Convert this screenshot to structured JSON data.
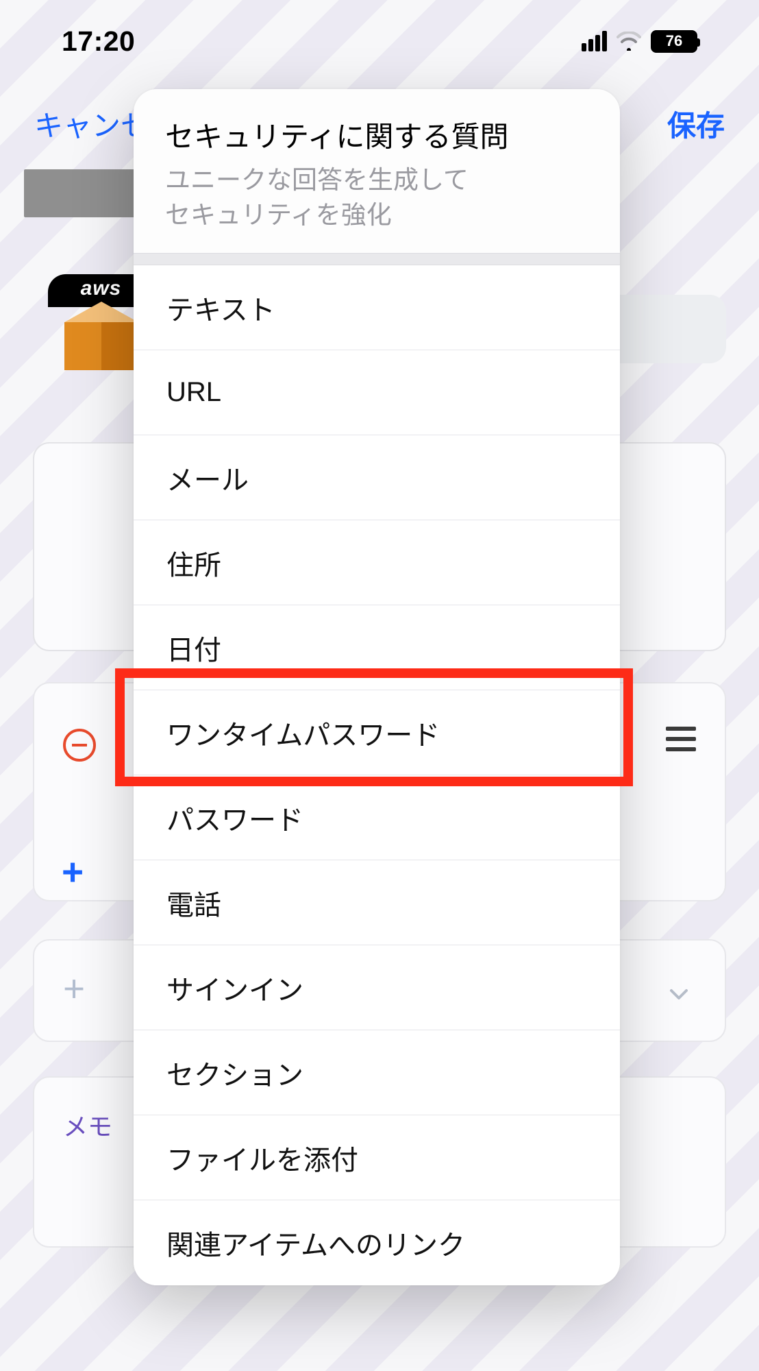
{
  "status": {
    "time": "17:20",
    "battery": "76"
  },
  "nav": {
    "cancel": "キャンセル",
    "save": "保存"
  },
  "background": {
    "aws_label": "aws",
    "memo_label": "メモ"
  },
  "sheet": {
    "header_title": "セキュリティに関する質問",
    "header_sub1": "ユニークな回答を生成して",
    "header_sub2": "セキュリティを強化",
    "items": [
      "テキスト",
      "URL",
      "メール",
      "住所",
      "日付",
      "ワンタイムパスワード",
      "パスワード",
      "電話",
      "サインイン",
      "セクション",
      "ファイルを添付",
      "関連アイテムへのリンク"
    ],
    "highlighted_index": 5
  }
}
